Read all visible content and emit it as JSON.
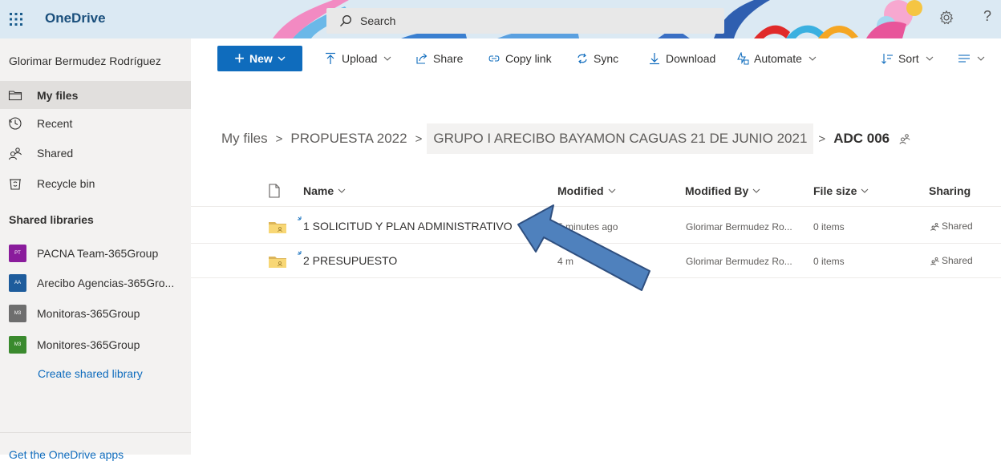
{
  "app": {
    "title": "OneDrive"
  },
  "search": {
    "placeholder": "Search"
  },
  "user": {
    "name": "Glorimar Bermudez Rodríguez"
  },
  "nav": {
    "items": [
      {
        "label": "My files",
        "icon": "folder-icon",
        "selected": true
      },
      {
        "label": "Recent",
        "icon": "clock-icon"
      },
      {
        "label": "Shared",
        "icon": "people-icon"
      },
      {
        "label": "Recycle bin",
        "icon": "trash-icon"
      }
    ],
    "libraries_heading": "Shared libraries",
    "libraries": [
      {
        "label": "PACNA Team-365Group",
        "badge": "PT",
        "color": "#8a1c9c"
      },
      {
        "label": "Arecibo Agencias-365Gro...",
        "badge": "AA",
        "color": "#1e5c9c"
      },
      {
        "label": "Monitoras-365Group",
        "badge": "M3",
        "color": "#6e6e6e"
      },
      {
        "label": "Monitores-365Group",
        "badge": "M3",
        "color": "#3a8a2e"
      }
    ],
    "create_library": "Create shared library",
    "get_apps": "Get the OneDrive apps"
  },
  "toolbar": {
    "new": "New",
    "upload": "Upload",
    "share": "Share",
    "copy_link": "Copy link",
    "sync": "Sync",
    "download": "Download",
    "automate": "Automate",
    "sort": "Sort"
  },
  "breadcrumb": {
    "items": [
      "My files",
      "PROPUESTA 2022",
      "GRUPO I ARECIBO BAYAMON CAGUAS 21 DE JUNIO 2021"
    ],
    "current": "ADC 006"
  },
  "columns": {
    "name": "Name",
    "modified": "Modified",
    "modified_by": "Modified By",
    "file_size": "File size",
    "sharing": "Sharing"
  },
  "files": [
    {
      "name": "1 SOLICITUD Y PLAN ADMINISTRATIVO",
      "modified": "5 minutes ago",
      "modified_by": "Glorimar Bermudez Ro...",
      "size": "0 items",
      "sharing": "Shared"
    },
    {
      "name": "2 PRESUPUESTO",
      "modified": "4 m",
      "modified_by": "Glorimar Bermudez Ro...",
      "size": "0 items",
      "sharing": "Shared"
    }
  ],
  "colors": {
    "accent": "#0f6cbd",
    "folder": "#f8d775",
    "arrow": "#4f81bd"
  }
}
